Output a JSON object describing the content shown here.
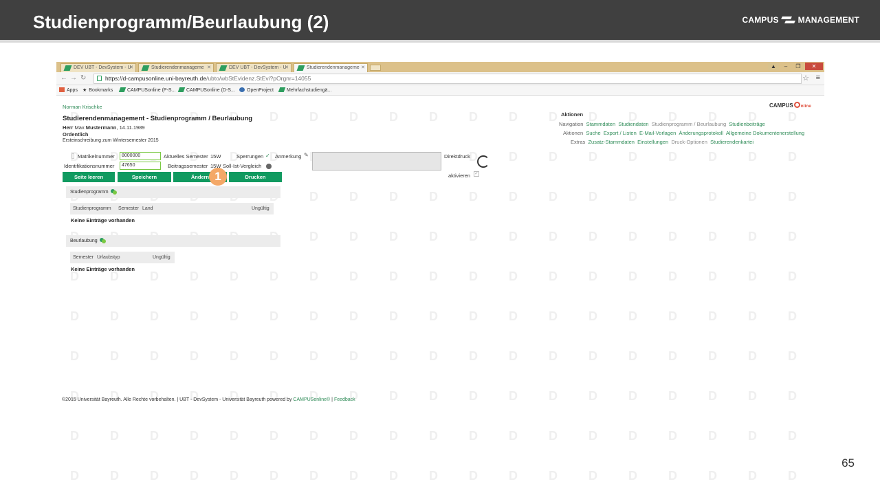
{
  "slide": {
    "title": "Studienprogramm/Beurlaubung (2)",
    "brand_left": "CAMPUS",
    "brand_right": "MANAGEMENT",
    "page_number": "65"
  },
  "browser": {
    "tabs": [
      {
        "label": "DEV UBT - DevSystem - U"
      },
      {
        "label": "Studierendenmanageme"
      },
      {
        "label": "DEV UBT - DevSystem - U"
      },
      {
        "label": "Studierendenmanageme"
      }
    ],
    "url_host": "https://d-campusonline.uni-bayreuth.de",
    "url_path": "/ubto/wbStEvidenz.StEvi?pOrgnr=14055",
    "bookmarks": [
      {
        "label": "Apps"
      },
      {
        "label": "Bookmarks"
      },
      {
        "label": "CAMPUSonline (P-S..."
      },
      {
        "label": "CAMPUSonline (D-S..."
      },
      {
        "label": "OpenProject"
      },
      {
        "label": "Mehrfachstudiengä..."
      }
    ]
  },
  "page": {
    "user_name": "Norman Krischke",
    "campus_logo_left": "CAMPUS",
    "campus_logo_right": "nline",
    "heading": "Studierendenmanagement - Studienprogramm / Beurlaubung",
    "student": {
      "salutation": "Herr",
      "first_name": "Max",
      "last_name": "Mustermann",
      "birth_date": "14.11.1989",
      "status": "Ordentlich",
      "enrollment": "Ersteinschreibung zum Wintersemester 2015"
    },
    "fields": {
      "matrikel_label": "Matrikelnummer",
      "matrikel_value": "8000000",
      "ident_label": "Identifikationsnummer",
      "ident_value": "47650",
      "akt_semester_label": "Aktuelles Semester",
      "akt_semester_value": "15W",
      "beitrags_label": "Beitragssemester",
      "beitrags_value": "15W",
      "sperrungen_label": "Sperrungen",
      "soll_ist_label": "Soll-Ist-Vergleich",
      "anmerkung_label": "Anmerkung",
      "direktdruck_label": "Direktdruck",
      "aktivieren_label": "aktivieren"
    },
    "buttons": {
      "seite_leeren": "Seite leeren",
      "speichern": "Speichern",
      "aendern": "Ändern",
      "drucken": "Drucken"
    },
    "callout": "1",
    "actions": {
      "title": "Aktionen",
      "navigation_label": "Navigation",
      "navigation": [
        "Stammdaten",
        "Studiendaten",
        "Studienprogramm / Beurlaubung",
        "Studienbeiträge"
      ],
      "aktionen_label": "Aktionen",
      "aktionen": [
        "Suche",
        "Export / Listen",
        "E-Mail-Vorlagen",
        "Änderungsprotokoll",
        "Allgemeine Dokumentenerstellung"
      ],
      "extras_label": "Extras",
      "extras": [
        "Zusatz-Stammdaten",
        "Einstellungen",
        "Druck-Optionen",
        "Studierendenkartei"
      ]
    },
    "studienprogramm": {
      "title": "Studienprogramm",
      "columns": [
        "Studienprogramm",
        "Semester",
        "Land",
        "Ungültig"
      ],
      "empty": "Keine Einträge vorhanden"
    },
    "beurlaubung": {
      "title": "Beurlaubung",
      "columns": [
        "Semester",
        "Urlaubstyp",
        "Ungültig"
      ],
      "empty": "Keine Einträge vorhanden"
    },
    "footer": {
      "text": "©2015 Universität Bayreuth. Alle Rechte vorbehalten. | UBT - DevSystem - Universität Bayreuth powered by",
      "powered_link": "CAMPUSonline®",
      "separator": "|",
      "feedback_link": "Feedback"
    }
  },
  "colors": {
    "header_bg": "#404040",
    "accent_green": "#119a60",
    "link_green": "#2e8b57",
    "callout_orange": "#f4a867"
  }
}
